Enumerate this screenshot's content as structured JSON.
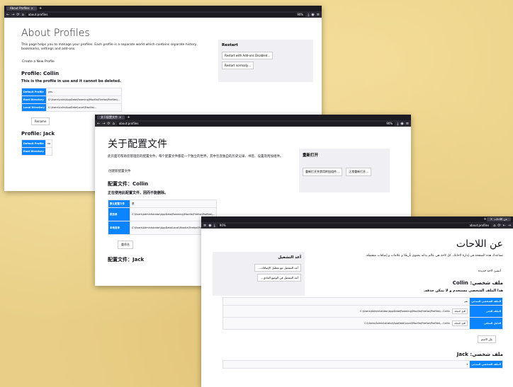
{
  "win1": {
    "tab_title": "About Profiles",
    "url": "about:profiles",
    "zoom": "90%",
    "title": "About Profiles",
    "desc": "This page helps you to manage your profiles. Each profile is a separate world which contains separate history, bookmarks, settings and add-ons.",
    "create": "Create a New Profile",
    "restart": {
      "heading": "Restart",
      "b1": "Restart with Add-ons Disabled…",
      "b2": "Restart normally…"
    },
    "profile1": {
      "heading": "Profile: Collin",
      "note": "This is the profile in use and it cannot be deleted.",
      "default_k": "Default Profile",
      "default_v": "yes",
      "root_k": "Root Directory",
      "root_v": "C:\\Users\\colin\\AppData\\Roaming\\Mozilla\\Firefox\\Profiles\\...",
      "local_k": "Local Directory",
      "local_v": "C:\\Users\\colin\\AppData\\Local\\Mozilla\\...",
      "rename": "Rename"
    },
    "profile2": {
      "heading": "Profile: Jack",
      "default_k": "Default Profile",
      "default_v": "no",
      "root_k": "Root Directory"
    }
  },
  "win2": {
    "tab_title": "关于配置文件",
    "url": "about:profiles",
    "zoom": "90%",
    "title": "关于配置文件",
    "desc": "此页面可帮助您管理您的配置文件。每个配置文件都是一个独立的世界，其中包含独自的历史记录、书签、设置及附加组件。",
    "create": "创建新配置文件",
    "restart": {
      "heading": "重新打开",
      "b1": "重新打开并禁用附加组件…",
      "b2": "正常重新打开…"
    },
    "profile1": {
      "heading": "配置文件：Collin",
      "note": "正在使用此配置文件，因而不能删除。",
      "default_k": "默认配置文件",
      "default_v": "是",
      "root_k": "根目录",
      "root_v": "C:\\Users\\Administrator\\AppData\\Roaming\\Mozilla\\Firefox\\Profiles\\...",
      "local_k": "本地目录",
      "local_v": "C:\\Users\\Administrator\\AppData\\Local\\Mozilla\\Firefox\\Profiles\\...",
      "rename": "重命名"
    },
    "profile2": {
      "heading": "配置文件：Jack"
    }
  },
  "win3": {
    "tab_title": "عن اللاحات",
    "url": "about:profiles",
    "zoom": "90%",
    "title": "عن اللاحات",
    "desc": "تساعدك هذه الصفحة في إدارة لاحاتك. كل لاحة هي عالم بذاته يحتوي تأريخًا و علامات و إضافات منفصلة.",
    "create": "أنشئ لاحة جديدة",
    "restart": {
      "heading": "أعد التشغيل",
      "b1": "أعد التشغيل مع تعطيل الإضافات…",
      "b2": "أعد التشغيل في الوضع العادي…"
    },
    "profile1": {
      "heading": "ملف شخصي: Collin",
      "note": "هذا الملف الشخصي مستخدم و لا يمكن حذفه.",
      "default_k": "الملف الشخصي المبدئي",
      "default_v": "نعم",
      "root_k": "الملف الجذر",
      "root_v": "C:\\Users\\Administrator\\AppData\\Roaming\\Mozilla\\Firefox\\Profiles\\...Collin",
      "root_act": "افتح المجلد",
      "local_k": "الدليل المحلي",
      "local_v": "C:\\Users\\Administrator\\AppData\\Local\\Mozilla\\Firefox\\Profiles\\...Collin",
      "local_act": "افتح المجلد",
      "rename": "غيّر الاسم"
    },
    "profile2": {
      "heading": "ملف شخصي: Jack",
      "default_k": "الملف الشخصي المبدئي",
      "default_v": "لا"
    }
  }
}
